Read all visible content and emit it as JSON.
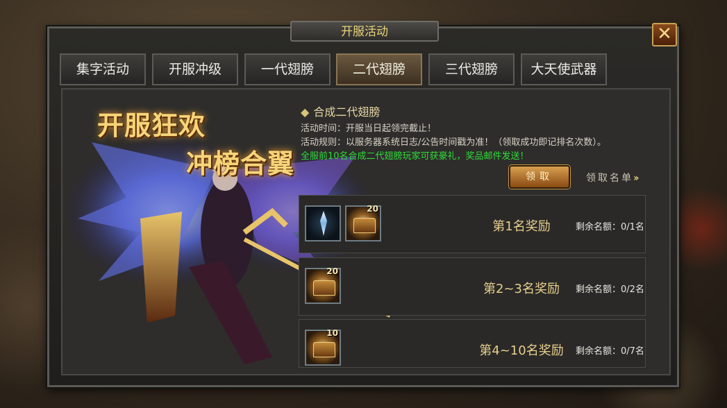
{
  "window": {
    "title": "开服活动",
    "close_label": "✕"
  },
  "tabs": [
    {
      "label": "集字活动",
      "active": false
    },
    {
      "label": "开服冲级",
      "active": false
    },
    {
      "label": "一代翅膀",
      "active": false
    },
    {
      "label": "二代翅膀",
      "active": true
    },
    {
      "label": "三代翅膀",
      "active": false
    },
    {
      "label": "大天使武器",
      "active": false
    }
  ],
  "hero": {
    "slogan_line1": "开服狂欢",
    "slogan_line2": "冲榜合翼"
  },
  "info": {
    "title": "合成二代翅膀",
    "time": "活动时间：开服当日起领完截止！",
    "rules": "活动规则：以服务器系统日志/公告时间戳为准！（领取成功即记排名次数）。",
    "note": "全服前10名合成二代翅膀玩家可获豪礼，奖品邮件发送！"
  },
  "claim_button": "领取",
  "list_link": "领取名单",
  "rewards": [
    {
      "rank": "第1名奖励",
      "remain": "剩余名额：0/1名",
      "items": [
        {
          "icon": "crystal-icon",
          "qty": ""
        },
        {
          "icon": "chest-icon",
          "qty": "20"
        }
      ]
    },
    {
      "rank": "第2~3名奖励",
      "remain": "剩余名额：0/2名",
      "items": [
        {
          "icon": "chest-icon",
          "qty": "20"
        }
      ]
    },
    {
      "rank": "第4~10名奖励",
      "remain": "剩余名额：0/7名",
      "items": [
        {
          "icon": "chest-icon",
          "qty": "10"
        }
      ]
    }
  ]
}
